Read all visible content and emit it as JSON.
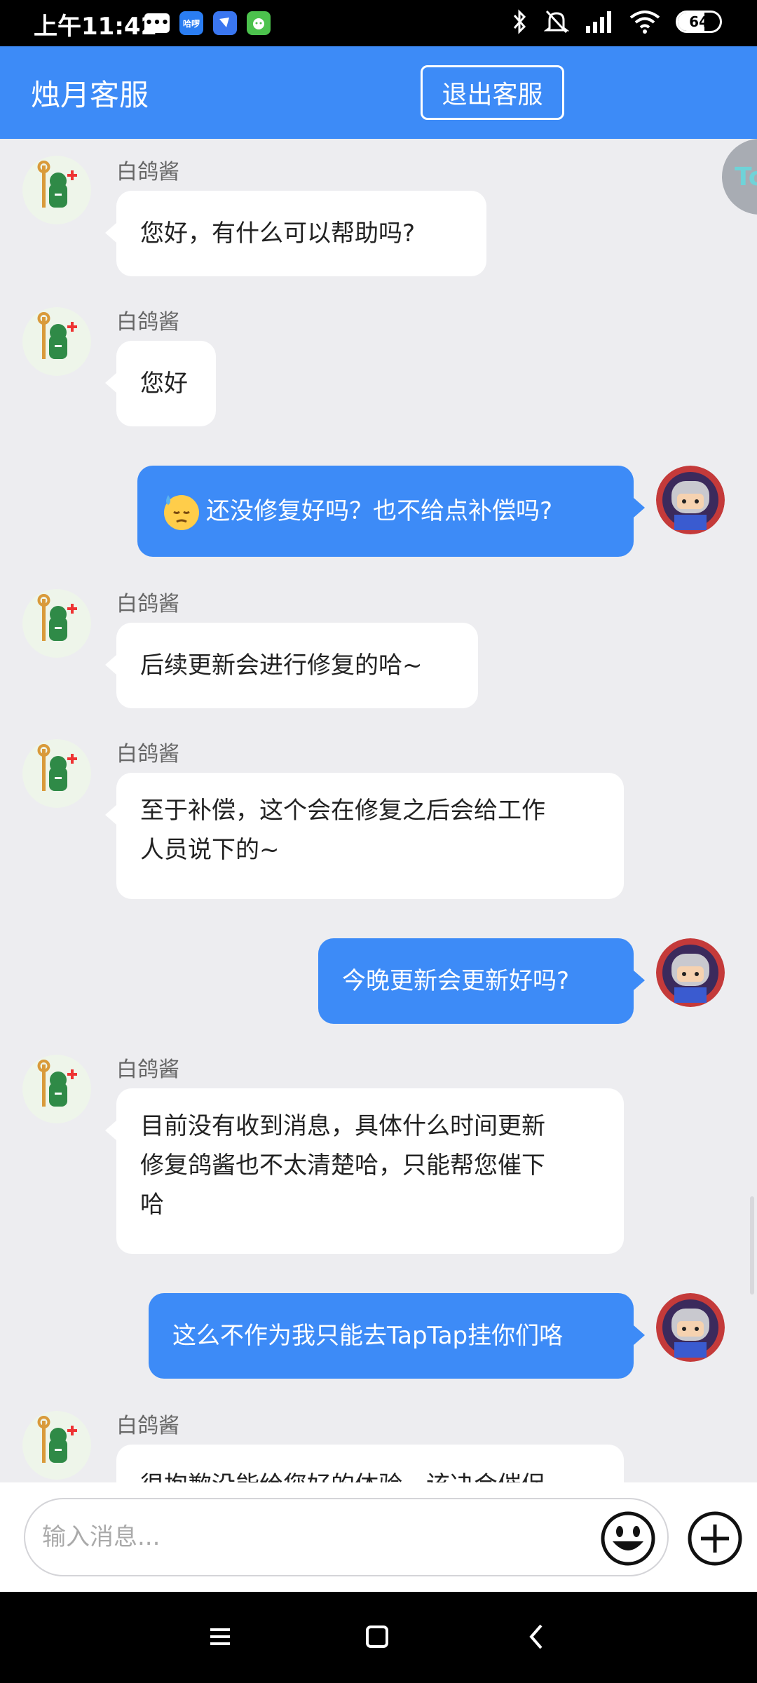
{
  "status_bar": {
    "time": "上午11:42",
    "battery": "64",
    "battery_level": 0.64,
    "app_icons": [
      "message-icon",
      "hello-app-icon",
      "feishu-app-icon",
      "wechat-app-icon"
    ],
    "indicators": [
      "bluetooth-icon",
      "mute-icon",
      "signal-icon",
      "wifi-icon",
      "battery-icon"
    ]
  },
  "header": {
    "title": "烛月客服",
    "exit_label": "退出客服",
    "color": "#3d8bf7"
  },
  "float_button_text": "To",
  "messages": [
    {
      "dir": "in",
      "sender": "白鸽酱",
      "text": "您好，有什么可以帮助吗?"
    },
    {
      "dir": "in",
      "sender": "白鸽酱",
      "text": "您好"
    },
    {
      "dir": "out",
      "text": "还没修复好吗？也不给点补偿吗?",
      "emoji": "sweat-face-emoji"
    },
    {
      "dir": "in",
      "sender": "白鸽酱",
      "text": "后续更新会进行修复的哈~"
    },
    {
      "dir": "in",
      "sender": "白鸽酱",
      "lines": [
        "至于补偿，这个会在修复之后会给工作",
        "人员说下的~"
      ]
    },
    {
      "dir": "out",
      "text": "今晚更新会更新好吗?"
    },
    {
      "dir": "in",
      "sender": "白鸽酱",
      "lines": [
        "目前没有收到消息，具体什么时间更新",
        "修复鸽酱也不太清楚哈，只能帮您催下",
        "哈"
      ]
    },
    {
      "dir": "out",
      "text": "这么不作为我只能去TapTap挂你们咯"
    },
    {
      "dir": "in",
      "sender": "白鸽酱",
      "text": "很抱歉没能给您好的体验，该决会催促"
    }
  ],
  "input": {
    "placeholder": "输入消息..."
  },
  "nav": [
    "menu-icon",
    "home-icon",
    "back-icon"
  ]
}
